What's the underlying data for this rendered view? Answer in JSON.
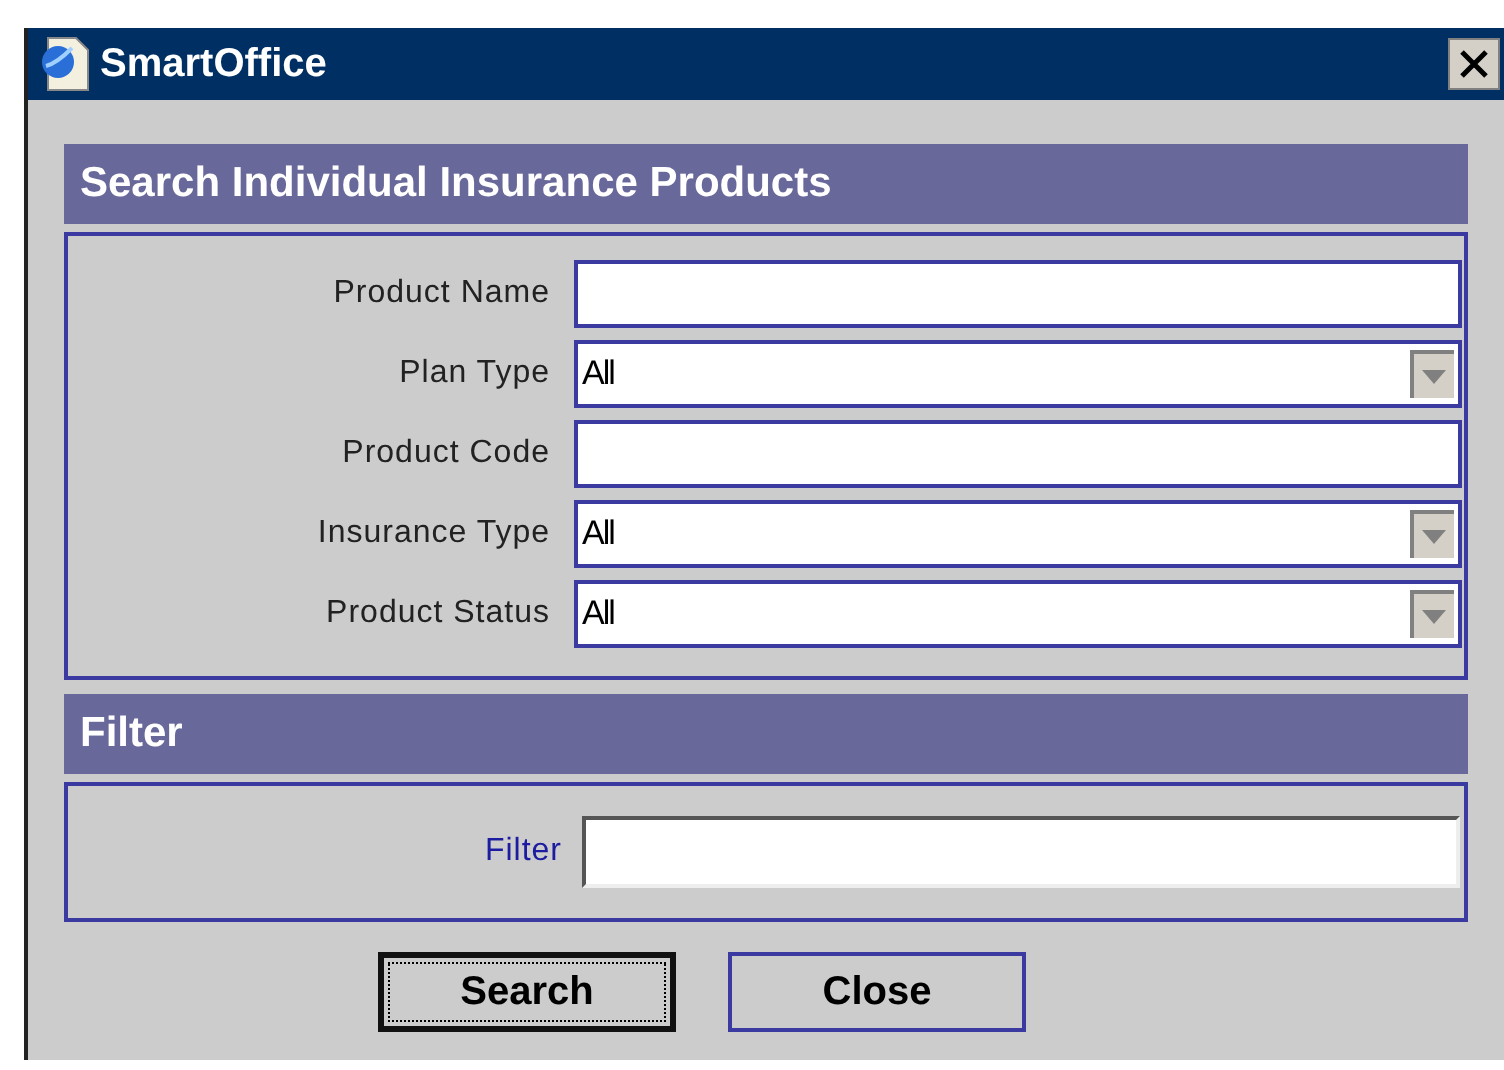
{
  "window": {
    "title": "SmartOffice"
  },
  "search_section": {
    "title": "Search Individual Insurance Products",
    "fields": [
      {
        "label": "Product Name",
        "kind": "text"
      },
      {
        "label": "Plan Type",
        "kind": "select",
        "value": "All"
      },
      {
        "label": "Product Code",
        "kind": "text"
      },
      {
        "label": "Insurance Type",
        "kind": "select",
        "value": "All"
      },
      {
        "label": "Product Status",
        "kind": "select",
        "value": "All"
      }
    ]
  },
  "filter_section": {
    "title": "Filter",
    "label": "Filter"
  },
  "buttons": [
    {
      "label": "Search",
      "focused": true
    },
    {
      "label": "Close",
      "focused": false
    }
  ]
}
